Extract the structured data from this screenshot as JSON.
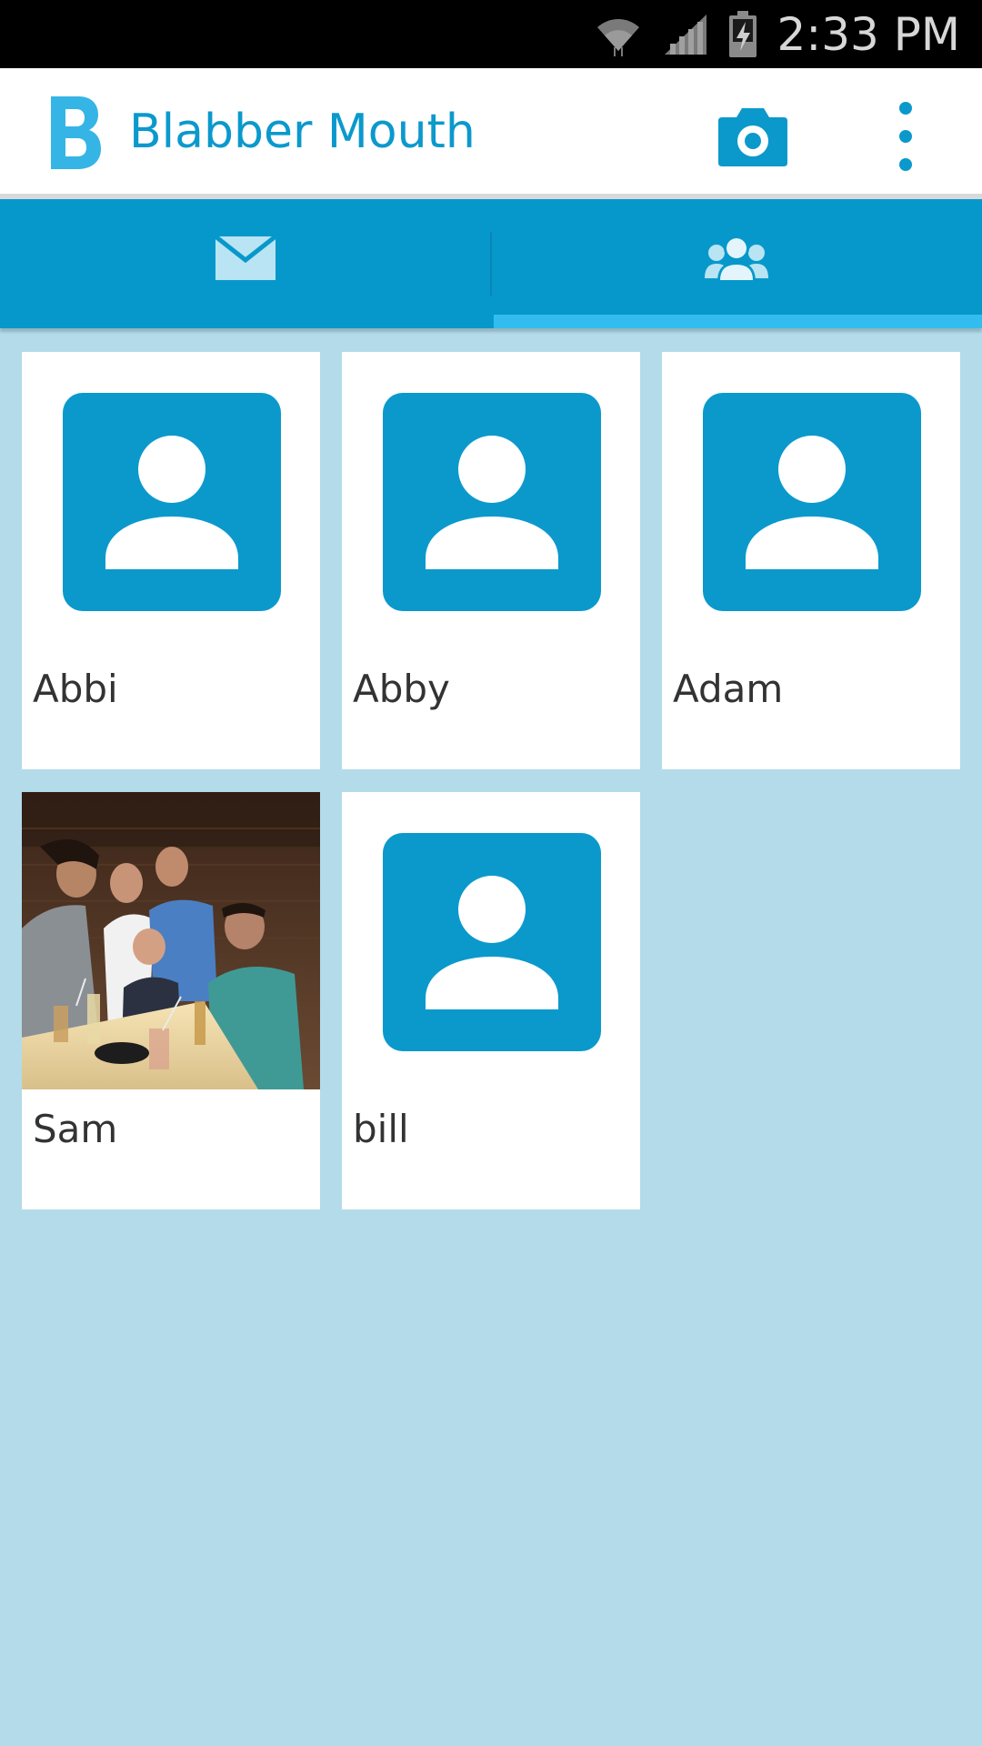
{
  "status_bar": {
    "time": "2:33 PM",
    "icons": [
      "wifi-icon",
      "signal-icon",
      "battery-charging-icon"
    ]
  },
  "app_bar": {
    "logo_letter": "B",
    "title": "Blabber Mouth",
    "actions": [
      "camera-icon",
      "overflow-menu-icon"
    ]
  },
  "tabs": [
    {
      "icon": "envelope-icon",
      "selected": false
    },
    {
      "icon": "contacts-group-icon",
      "selected": true
    }
  ],
  "colors": {
    "accent": "#0b99cc",
    "tab_bar": "#0798cb",
    "tab_indicator": "#33bdef",
    "background": "#b3dbea"
  },
  "contacts": [
    {
      "name": "Abbi",
      "avatar": "default-person-icon"
    },
    {
      "name": "Abby",
      "avatar": "default-person-icon"
    },
    {
      "name": "Adam",
      "avatar": "default-person-icon"
    },
    {
      "name": "Sam",
      "avatar": "photo"
    },
    {
      "name": "bill",
      "avatar": "default-person-icon"
    }
  ]
}
